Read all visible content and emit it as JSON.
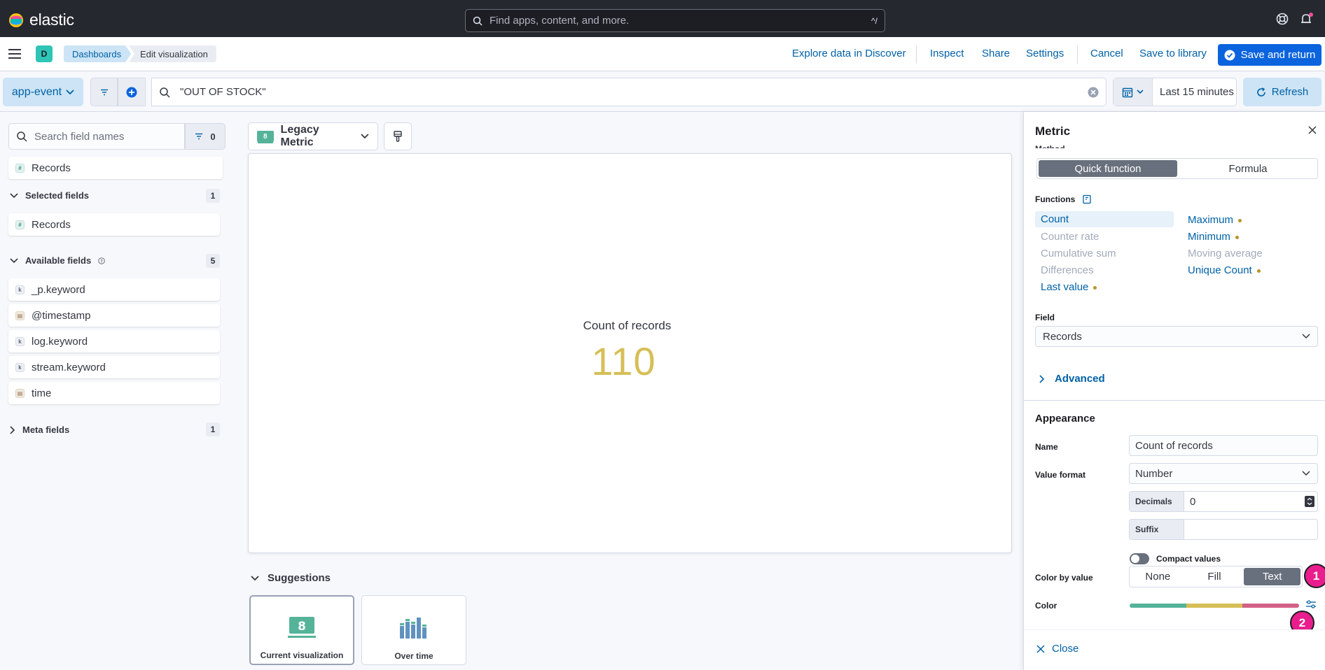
{
  "header": {
    "brand": "elastic",
    "search_placeholder": "Find apps, content, and more.",
    "search_shortcut": "^/"
  },
  "nav": {
    "space_initial": "D",
    "breadcrumbs": [
      "Dashboards",
      "Edit visualization"
    ],
    "links": {
      "explore": "Explore data in Discover",
      "inspect": "Inspect",
      "share": "Share",
      "settings": "Settings",
      "cancel": "Cancel",
      "save_library": "Save to library",
      "save_return": "Save and return"
    }
  },
  "query": {
    "data_view": "app-event",
    "text": "\"OUT OF STOCK\"",
    "time_range": "Last 15 minutes",
    "refresh": "Refresh"
  },
  "sidebar": {
    "search_placeholder": "Search field names",
    "filter_count": "0",
    "top_field": "Records",
    "selected": {
      "label": "Selected fields",
      "count": "1",
      "fields": [
        {
          "name": "Records",
          "type": "number"
        }
      ]
    },
    "available": {
      "label": "Available fields",
      "count": "5",
      "fields": [
        {
          "name": "_p.keyword",
          "type": "keyword"
        },
        {
          "name": "@timestamp",
          "type": "date"
        },
        {
          "name": "log.keyword",
          "type": "keyword"
        },
        {
          "name": "stream.keyword",
          "type": "keyword"
        },
        {
          "name": "time",
          "type": "date"
        }
      ]
    },
    "meta": {
      "label": "Meta fields",
      "count": "1"
    }
  },
  "workspace": {
    "vis_type": "Legacy Metric",
    "vis_badge": "8",
    "metric_label": "Count of records",
    "metric_value": "110",
    "metric_color": "#d6bf57",
    "suggestions_title": "Suggestions",
    "suggestions": [
      {
        "label": "Current visualization",
        "icon": "metric-icon"
      },
      {
        "label": "Over time",
        "icon": "bar-chart-icon"
      }
    ]
  },
  "panel": {
    "title": "Metric",
    "method_label": "Method",
    "method_options": [
      "Quick function",
      "Formula"
    ],
    "method_selected": "Quick function",
    "functions_label": "Functions",
    "functions_left": [
      {
        "name": "Count",
        "state": "selected",
        "dot": false
      },
      {
        "name": "Counter rate",
        "state": "disabled",
        "dot": false
      },
      {
        "name": "Cumulative sum",
        "state": "disabled",
        "dot": false
      },
      {
        "name": "Differences",
        "state": "disabled",
        "dot": false
      },
      {
        "name": "Last value",
        "state": "enabled",
        "dot": true
      }
    ],
    "functions_right": [
      {
        "name": "Maximum",
        "state": "enabled",
        "dot": true
      },
      {
        "name": "Minimum",
        "state": "enabled",
        "dot": true
      },
      {
        "name": "Moving average",
        "state": "disabled",
        "dot": false
      },
      {
        "name": "Unique Count",
        "state": "enabled",
        "dot": true
      }
    ],
    "field_label": "Field",
    "field_value": "Records",
    "advanced": "Advanced",
    "appearance": "Appearance",
    "name_label": "Name",
    "name_value": "Count of records",
    "value_format_label": "Value format",
    "value_format": "Number",
    "decimals_label": "Decimals",
    "decimals_value": "0",
    "suffix_label": "Suffix",
    "suffix_value": "",
    "compact_label": "Compact values",
    "color_by_label": "Color by value",
    "color_by_options": [
      "None",
      "Fill",
      "Text"
    ],
    "color_by_selected": "Text",
    "color_label": "Color",
    "palette": [
      "#54b399",
      "#d6bf57",
      "#d36086"
    ],
    "close": "Close",
    "markers": [
      "1",
      "2"
    ]
  }
}
